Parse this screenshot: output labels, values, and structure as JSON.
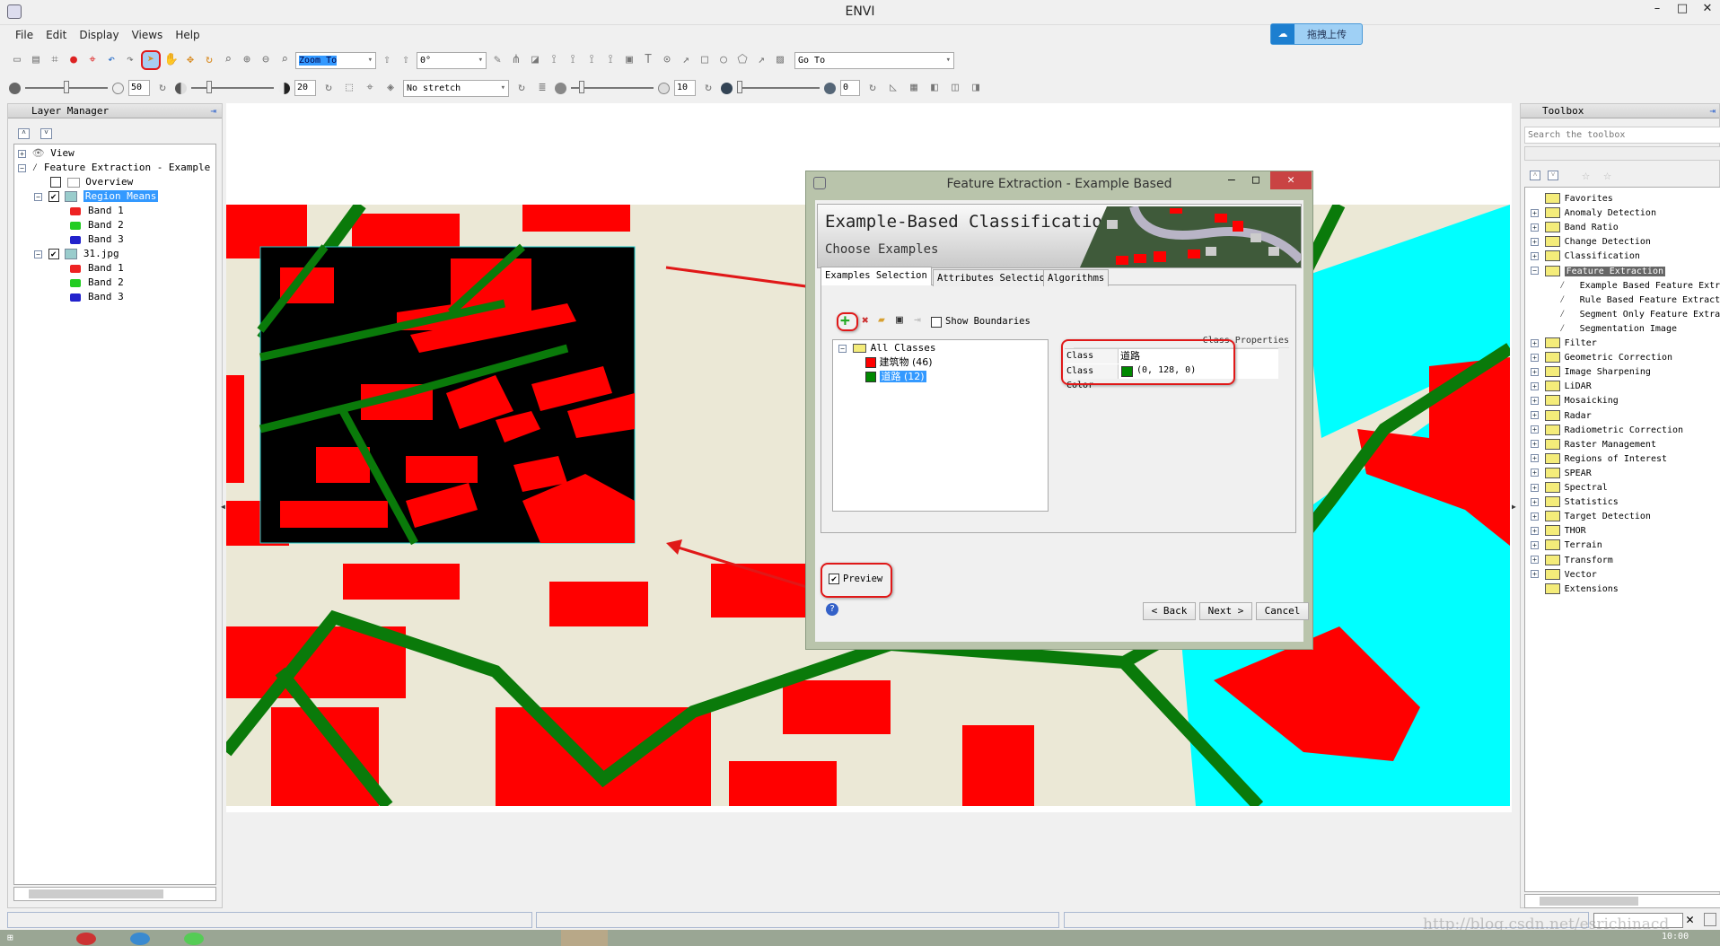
{
  "app": {
    "title": "ENVI",
    "upload_badge": "拖拽上传",
    "watermark": "http://blog.csdn.net/esrichinacd",
    "clock": "10:00"
  },
  "menu": [
    "File",
    "Edit",
    "Display",
    "Views",
    "Help"
  ],
  "toolbar": {
    "zoom_to": "Zoom To",
    "rotation": "0°",
    "goto": "Go To",
    "brightness": "50",
    "contrast": "20",
    "stretch": "No stretch",
    "sharpen": "10",
    "transparency": "0",
    "brightness_level": 0.5,
    "contrast_level": 0.2,
    "sharpen_level": 0.1,
    "transparency_level": 0,
    "active_tool": "select-pointer-icon"
  },
  "layer_manager": {
    "title": "Layer Manager",
    "items": [
      {
        "label": "View"
      },
      {
        "label": "Feature Extraction - Example"
      },
      {
        "label": "Overview",
        "checked": false
      },
      {
        "label": "Region Means",
        "checked": true,
        "selected": true
      },
      {
        "label": "Band 1"
      },
      {
        "label": "Band 2"
      },
      {
        "label": "Band 3"
      },
      {
        "label": "31.jpg",
        "checked": true
      },
      {
        "label": "Band 1"
      },
      {
        "label": "Band 2"
      },
      {
        "label": "Band 3"
      }
    ]
  },
  "toolbox": {
    "title": "Toolbox",
    "search_placeholder": "Search the toolbox",
    "items": [
      "Favorites",
      "Anomaly Detection",
      "Band Ratio",
      "Change Detection",
      "Classification",
      "Feature Extraction",
      "Example Based Feature Extraction",
      "Rule Based Feature Extraction",
      "Segment Only Feature Extraction",
      "Segmentation Image",
      "Filter",
      "Geometric Correction",
      "Image Sharpening",
      "LiDAR",
      "Mosaicking",
      "Radar",
      "Radiometric Correction",
      "Raster Management",
      "Regions of Interest",
      "SPEAR",
      "Spectral",
      "Statistics",
      "Target Detection",
      "THOR",
      "Terrain",
      "Transform",
      "Vector",
      "Extensions"
    ],
    "selected": "Feature Extraction"
  },
  "dialog": {
    "title": "Feature Extraction - Example Based",
    "banner_title": "Example-Based Classification",
    "banner_subtitle": "Choose Examples",
    "tabs": [
      "Examples Selection",
      "Attributes Selection",
      "Algorithms"
    ],
    "active_tab": "Examples Selection",
    "show_boundaries": "Show Boundaries",
    "show_boundaries_checked": false,
    "tree_root": "All Classes",
    "classes": [
      {
        "name": "建筑物",
        "count": "(46)",
        "color": "#ff0000"
      },
      {
        "name": "道路",
        "count": "(12)",
        "color": "#008000",
        "selected": true
      }
    ],
    "class_properties": {
      "header": "Class Properties",
      "name_label": "Class Name",
      "name_value": "道路",
      "color_label": "Class Color",
      "color_value": "(0, 128, 0)"
    },
    "preview": "Preview",
    "preview_checked": true,
    "back": "< Back",
    "next": "Next >",
    "cancel": "Cancel"
  },
  "colors": {
    "building": "#ff0000",
    "road": "#008000",
    "water": "#00ffff",
    "background": "#ebe8d6",
    "selection": "#3399ff",
    "annotation": "#e01818"
  }
}
